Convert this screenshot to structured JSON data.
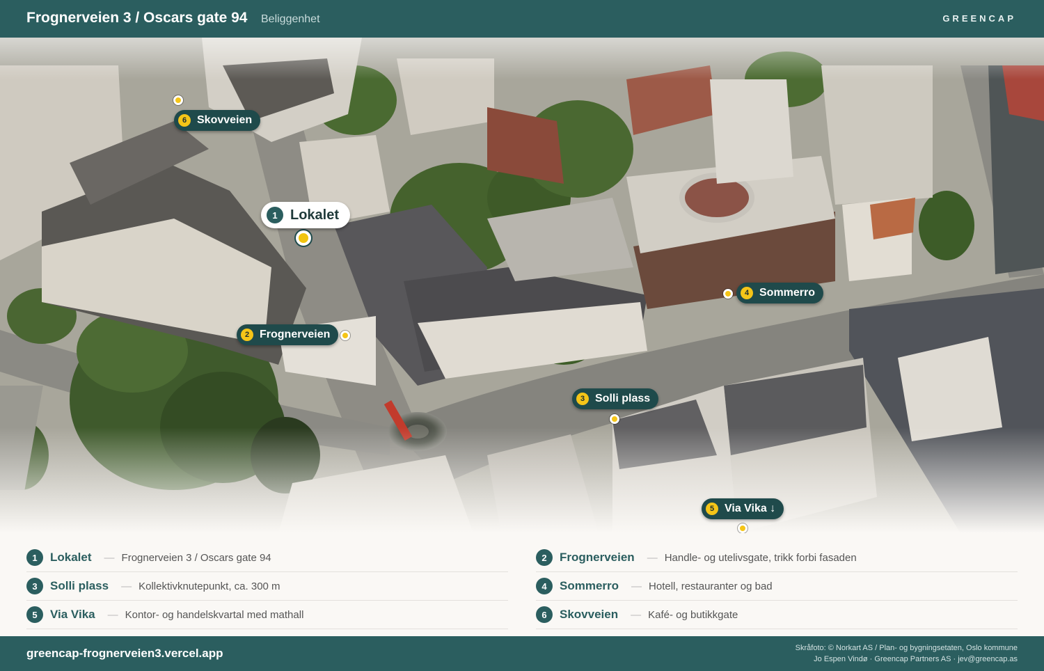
{
  "header": {
    "title": "Frognerveien 3 / Oscars gate 94",
    "subtitle": "Beliggenhet",
    "brand": "GREENCAP"
  },
  "colors": {
    "header_bg": "#2b5e5f",
    "marker_yellow": "#f5c518",
    "pill_bg": "#1f4a4b",
    "legend_bg": "#faf8f5"
  },
  "map": {
    "image": "aerial photo of Solli plass, Oslo",
    "labels": [
      {
        "num": "1",
        "name": "Lokalet"
      },
      {
        "num": "2",
        "name": "Frognerveien"
      },
      {
        "num": "3",
        "name": "Solli plass"
      },
      {
        "num": "4",
        "name": "Sommerro"
      },
      {
        "num": "5",
        "name": "Via Vika ↓"
      },
      {
        "num": "6",
        "name": "Skovveien"
      }
    ]
  },
  "legend": [
    {
      "num": "1",
      "name": "Lokalet",
      "desc": "Frognerveien 3 / Oscars gate 94"
    },
    {
      "num": "2",
      "name": "Frognerveien",
      "desc": "Handle- og utelivsgate, trikk forbi fasaden"
    },
    {
      "num": "3",
      "name": "Solli plass",
      "desc": "Kollektivknutepunkt, ca. 300 m"
    },
    {
      "num": "4",
      "name": "Sommerro",
      "desc": "Hotell, restauranter og bad"
    },
    {
      "num": "5",
      "name": "Via Vika",
      "desc": "Kontor- og handelskvartal med mathall"
    },
    {
      "num": "6",
      "name": "Skovveien",
      "desc": "Kafé- og butikkgate"
    }
  ],
  "legend_dash": "—",
  "footer": {
    "url": "greencap-frognerveien3.vercel.app",
    "credit_line1": "Skråfoto: © Norkart AS / Plan- og bygningsetaten, Oslo kommune",
    "credit_line2": "Jo Espen Vindø · Greencap Partners AS · jev@greencap.as"
  }
}
